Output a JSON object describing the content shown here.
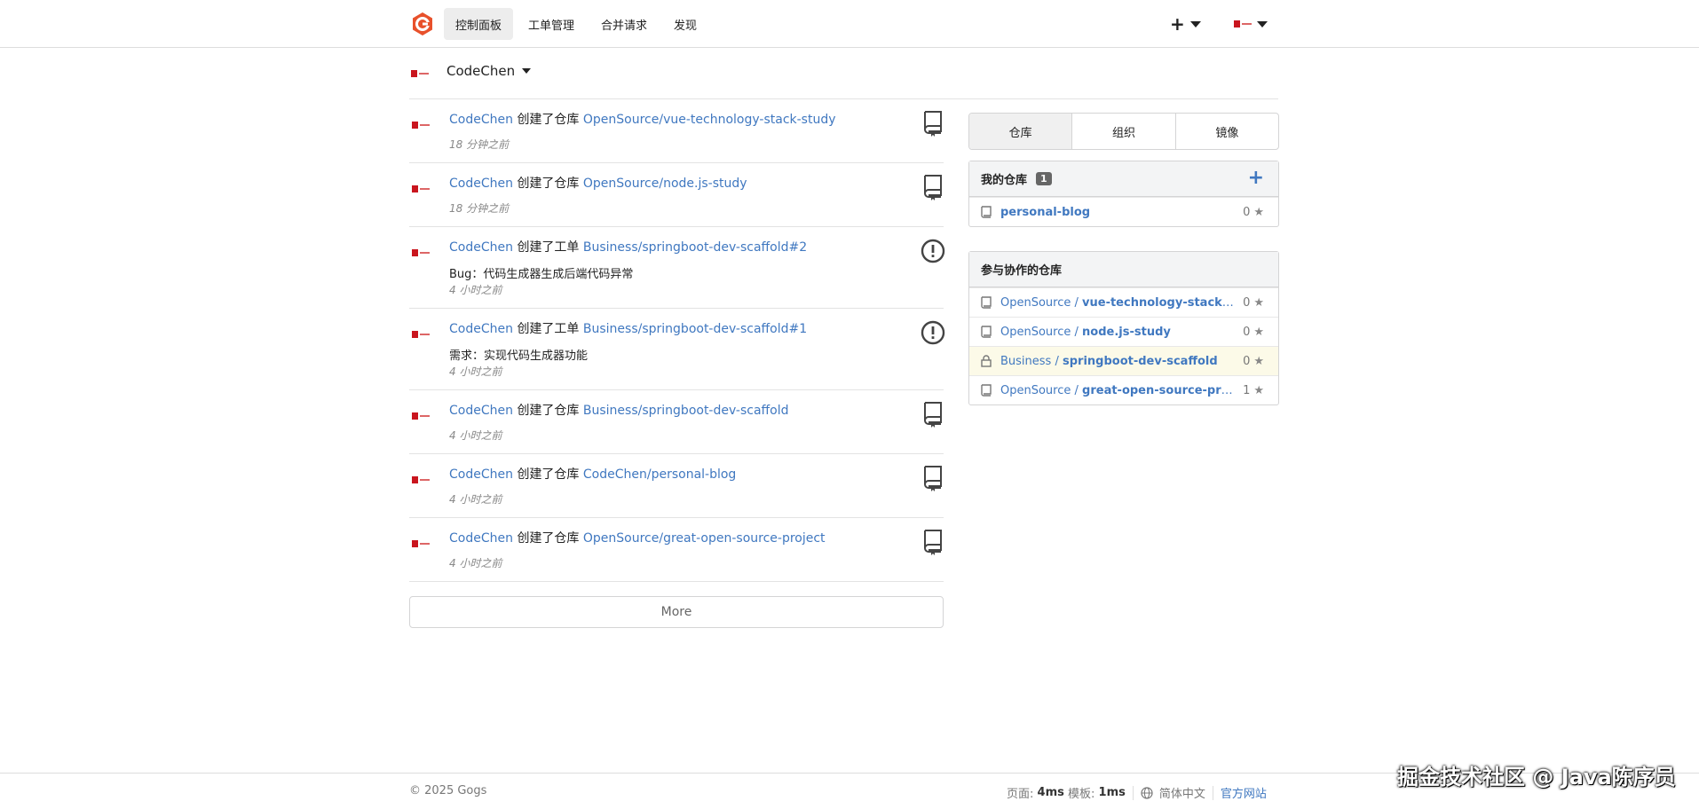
{
  "nav": {
    "items": [
      {
        "label": "控制面板",
        "active": true
      },
      {
        "label": "工单管理"
      },
      {
        "label": "合并请求"
      },
      {
        "label": "发现"
      }
    ],
    "logo_color": "#e8512b"
  },
  "context": {
    "user": "CodeChen"
  },
  "feed": [
    {
      "user": "CodeChen",
      "action": "创建了仓库",
      "target": "OpenSource/vue-technology-stack-study",
      "desc": "",
      "time": "18 分钟之前",
      "icon": "repo-icon"
    },
    {
      "user": "CodeChen",
      "action": "创建了仓库",
      "target": "OpenSource/node.js-study",
      "desc": "",
      "time": "18 分钟之前",
      "icon": "repo-icon"
    },
    {
      "user": "CodeChen",
      "action": "创建了工单",
      "target": "Business/springboot-dev-scaffold#2",
      "desc": "Bug：代码生成器生成后端代码异常",
      "time": "4 小时之前",
      "icon": "issue-icon"
    },
    {
      "user": "CodeChen",
      "action": "创建了工单",
      "target": "Business/springboot-dev-scaffold#1",
      "desc": "需求：实现代码生成器功能",
      "time": "4 小时之前",
      "icon": "issue-icon"
    },
    {
      "user": "CodeChen",
      "action": "创建了仓库",
      "target": "Business/springboot-dev-scaffold",
      "desc": "",
      "time": "4 小时之前",
      "icon": "repo-icon"
    },
    {
      "user": "CodeChen",
      "action": "创建了仓库",
      "target": "CodeChen/personal-blog",
      "desc": "",
      "time": "4 小时之前",
      "icon": "repo-icon"
    },
    {
      "user": "CodeChen",
      "action": "创建了仓库",
      "target": "OpenSource/great-open-source-project",
      "desc": "",
      "time": "4 小时之前",
      "icon": "repo-icon"
    }
  ],
  "more_label": "More",
  "tabs": [
    "仓库",
    "组织",
    "镜像"
  ],
  "my_repos": {
    "title": "我的仓库",
    "count": "1",
    "items": [
      {
        "owner": "",
        "name": "personal-blog",
        "stars": "0",
        "private": false
      }
    ]
  },
  "collab_repos": {
    "title": "参与协作的仓库",
    "items": [
      {
        "owner": "OpenSource",
        "name": "vue-technology-stack-study",
        "stars": "0",
        "private": false
      },
      {
        "owner": "OpenSource",
        "name": "node.js-study",
        "stars": "0",
        "private": false
      },
      {
        "owner": "Business",
        "name": "springboot-dev-scaffold",
        "stars": "0",
        "private": true
      },
      {
        "owner": "OpenSource",
        "name": "great-open-source-project",
        "stars": "1",
        "private": false
      }
    ]
  },
  "footer": {
    "copyright": "© 2025 Gogs",
    "page_label": "页面:",
    "page_time": "4ms",
    "template_label": "模板:",
    "template_time": "1ms",
    "language": "简体中文",
    "site_link": "官方网站"
  },
  "watermark": "掘金技术社区 @ Java陈序员"
}
